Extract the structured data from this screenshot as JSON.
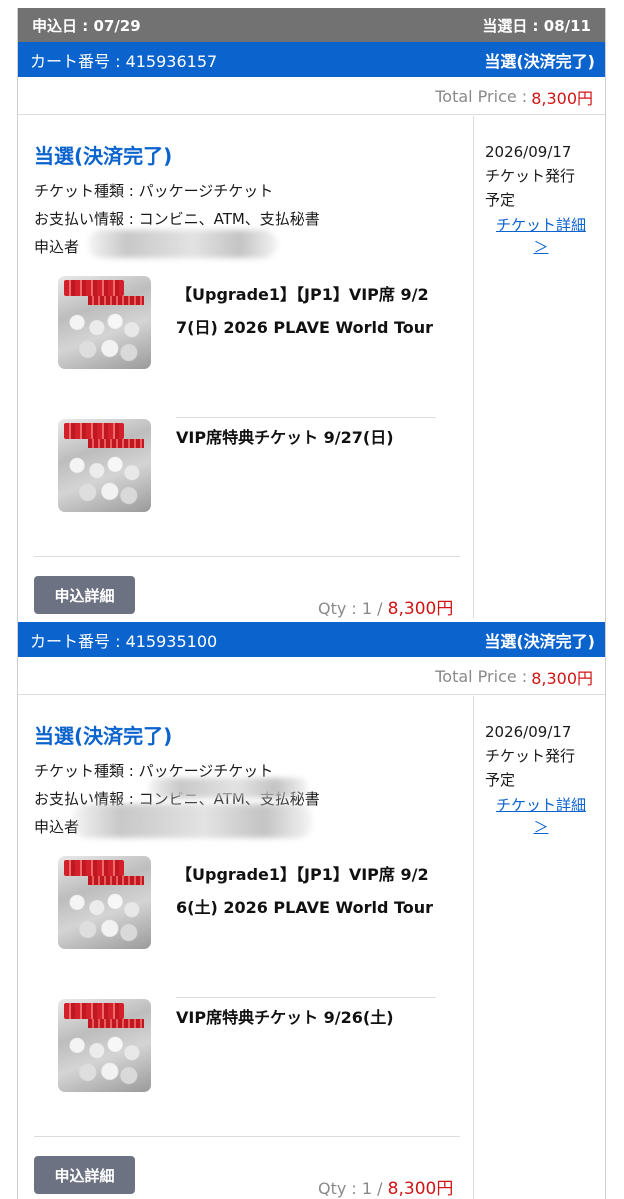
{
  "header": {
    "apply_date": "申込日 : 07/29",
    "result_date": "当選日 : 08/11"
  },
  "orders": [
    {
      "cart_label": "カート番号 : 415936157",
      "status": "当選(決済完了)",
      "total_label": "Total Price :",
      "total_amount": "8,300円",
      "status_title": "当選(決済完了)",
      "ticket_type": "チケット種類 : パッケージチケット",
      "payment": "お支払い情報 : コンビニ、ATM、支払秘書",
      "applicant_label": "申込者",
      "items": [
        {
          "name": "【Upgrade1】【JP1】VIP席 9/27(日) 2026 PLAVE World Tour"
        },
        {
          "name": "VIP席特典チケット 9/27(日)"
        }
      ],
      "detail_button": "申込詳細",
      "qty_label": "Qty : 1 /",
      "qty_amount": "8,300円",
      "issue_date": "2026/09/17",
      "issue_text": "チケット発行",
      "issue_text2": "予定",
      "ticket_link": "チケット詳細",
      "ticket_link_arrow": "＞"
    },
    {
      "cart_label": "カート番号 : 415935100",
      "status": "当選(決済完了)",
      "total_label": "Total Price :",
      "total_amount": "8,300円",
      "status_title": "当選(決済完了)",
      "ticket_type": "チケット種類 : パッケージチケット",
      "payment": "お支払い情報 : コンビニ、ATM、支払秘書",
      "applicant_label": "申込者",
      "items": [
        {
          "name": "【Upgrade1】【JP1】VIP席 9/26(土) 2026 PLAVE World Tour"
        },
        {
          "name": "VIP席特典チケット 9/26(土)"
        }
      ],
      "detail_button": "申込詳細",
      "qty_label": "Qty : 1 /",
      "qty_amount": "8,300円",
      "issue_date": "2026/09/17",
      "issue_text": "チケット発行",
      "issue_text2": "予定",
      "ticket_link": "チケット詳細",
      "ticket_link_arrow": "＞"
    }
  ],
  "colors": {
    "accent_blue": "#0b63ce",
    "price_red": "#d01515",
    "header_gray": "#727272",
    "button_gray": "#6d7282"
  }
}
